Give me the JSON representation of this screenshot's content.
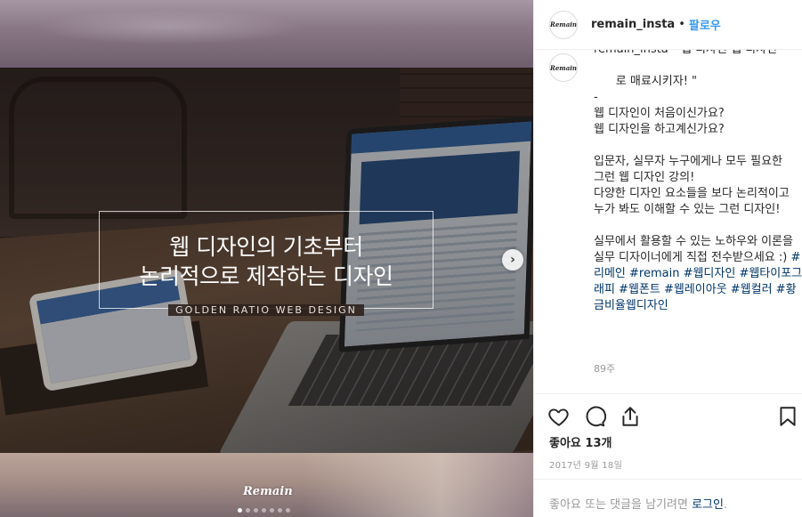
{
  "post": {
    "overlay_line1": "웹 디자인의 기초부터",
    "overlay_line2": "논리적으로 제작하는 디자인",
    "overlay_subtitle": "GOLDEN RATIO WEB DESIGN",
    "watermark": "Remain",
    "carousel_count": 7,
    "carousel_active": 0
  },
  "header": {
    "avatar_text": "Remain",
    "username": "remain_insta",
    "separator": "•",
    "follow": "팔로우"
  },
  "comment": {
    "partial_top": "remain_insta \" 웹 디자인 웹 디자인",
    "body": "로 매료시키자! \"\n-\n웹 디자인이 처음이신가요?\n웹 디자인을 하고계신가요?\n\n입문자, 실무자 누구에게나 모두 필요한\n그런 웹 디자인 강의!\n다양한 디자인 요소들을 보다 논리적이고\n누가 봐도 이해할 수 있는 그런 디자인!\n\n실무에서 활용할 수 있는 노하우와 이론을\n실무 디자이너에게 직접 전수받으세요 :) ",
    "hashtags": "#리메인 #remain #웹디자인 #웹타이포그래피 #웹폰트 #웹레이아웃 #웹컬러 #황금비율웹디자인",
    "age": "89주"
  },
  "actions": {
    "like_icon": "heart-icon",
    "comment_icon": "comment-icon",
    "share_icon": "share-icon",
    "save_icon": "bookmark-icon"
  },
  "likes": "좋아요 13개",
  "date": "2017년 9월 18일",
  "login_prompt": {
    "text": "좋아요 또는 댓글을 남기려면 ",
    "link": "로그인",
    "suffix": "."
  }
}
